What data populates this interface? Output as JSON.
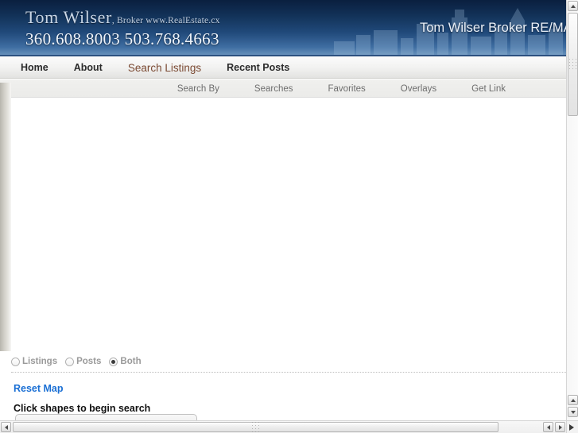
{
  "banner": {
    "brand_name": "Tom Wilser",
    "brand_sub": ", Broker www.RealEstate.cx",
    "phones": "360.608.8003 503.768.4663",
    "right_title": "Tom Wilser Broker RE/MA",
    "gradient_top": "#0a1f3f",
    "gradient_bottom": "#6b94bd"
  },
  "mainnav": {
    "items": [
      {
        "label": "Home",
        "active": false
      },
      {
        "label": "About",
        "active": false
      },
      {
        "label": "Search Listings",
        "active": true
      },
      {
        "label": "Recent Posts",
        "active": false
      }
    ],
    "active_color": "#7b4a33"
  },
  "subnav": {
    "items": [
      {
        "label": "Search By"
      },
      {
        "label": "Searches"
      },
      {
        "label": "Favorites"
      },
      {
        "label": "Overlays"
      },
      {
        "label": "Get Link"
      }
    ]
  },
  "controls": {
    "radio_group": {
      "options": [
        {
          "label": "Listings",
          "checked": false
        },
        {
          "label": "Posts",
          "checked": false
        },
        {
          "label": "Both",
          "checked": true
        }
      ]
    },
    "reset_link": "Reset Map",
    "reset_link_color": "#1a6fd4",
    "search_heading": "Click shapes to begin search",
    "search_input": {
      "value": "",
      "placeholder": ""
    }
  },
  "scrollbars": {
    "vertical_inner": {
      "thumb_position": "top"
    },
    "horizontal_outer": {
      "thumb_position": "left"
    }
  }
}
